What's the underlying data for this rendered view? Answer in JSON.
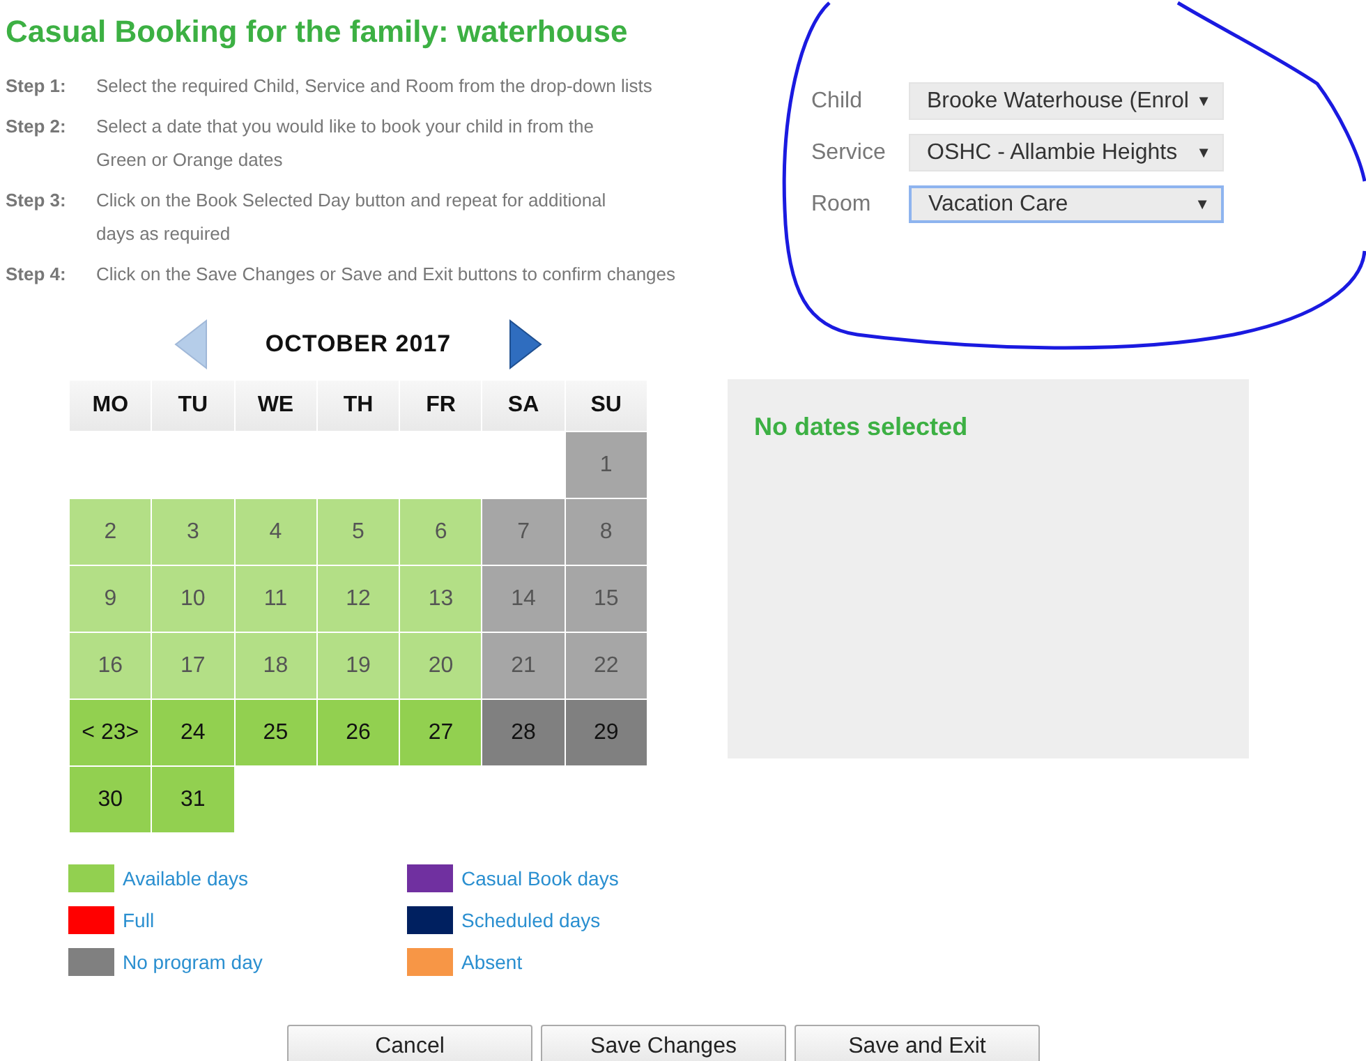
{
  "title": "Casual Booking for the family: waterhouse",
  "steps": [
    {
      "label": "Step 1:",
      "text": "Select the required Child, Service and Room from the drop-down lists"
    },
    {
      "label": "Step 2:",
      "text": "Select a date that you would like to book your child in from the Green or Orange dates"
    },
    {
      "label": "Step 3:",
      "text": "Click on the Book Selected Day button and repeat for additional days as required"
    },
    {
      "label": "Step 4:",
      "text": "Click on the Save Changes or Save and Exit buttons to confirm changes"
    }
  ],
  "selectors": [
    {
      "label": "Child",
      "value": "Brooke Waterhouse (Enrol",
      "caret": "▼",
      "focused": false
    },
    {
      "label": "Service",
      "value": "OSHC - Allambie Heights",
      "caret": "▼",
      "focused": false
    },
    {
      "label": "Room",
      "value": "Vacation Care",
      "caret": "▼",
      "focused": true
    }
  ],
  "calendar": {
    "month": "OCTOBER 2017",
    "prev_enabled": false,
    "next_enabled": true,
    "weekdays": [
      "MO",
      "TU",
      "WE",
      "TH",
      "FR",
      "SA",
      "SU"
    ],
    "weeks": [
      [
        {
          "day": "1",
          "kind": "past-closed"
        }
      ],
      [
        {
          "day": "2",
          "kind": "past"
        },
        {
          "day": "3",
          "kind": "past"
        },
        {
          "day": "4",
          "kind": "past"
        },
        {
          "day": "5",
          "kind": "past"
        },
        {
          "day": "6",
          "kind": "past"
        },
        {
          "day": "7",
          "kind": "past-closed"
        },
        {
          "day": "8",
          "kind": "past-closed"
        }
      ],
      [
        {
          "day": "9",
          "kind": "past"
        },
        {
          "day": "10",
          "kind": "past"
        },
        {
          "day": "11",
          "kind": "past"
        },
        {
          "day": "12",
          "kind": "past"
        },
        {
          "day": "13",
          "kind": "past"
        },
        {
          "day": "14",
          "kind": "past-closed"
        },
        {
          "day": "15",
          "kind": "past-closed"
        }
      ],
      [
        {
          "day": "16",
          "kind": "past"
        },
        {
          "day": "17",
          "kind": "past"
        },
        {
          "day": "18",
          "kind": "past"
        },
        {
          "day": "19",
          "kind": "past"
        },
        {
          "day": "20",
          "kind": "past"
        },
        {
          "day": "21",
          "kind": "past-closed"
        },
        {
          "day": "22",
          "kind": "past-closed"
        }
      ],
      [
        {
          "day": "< 23>",
          "kind": "available"
        },
        {
          "day": "24",
          "kind": "available"
        },
        {
          "day": "25",
          "kind": "available"
        },
        {
          "day": "26",
          "kind": "available"
        },
        {
          "day": "27",
          "kind": "available"
        },
        {
          "day": "28",
          "kind": "closed"
        },
        {
          "day": "29",
          "kind": "closed"
        }
      ],
      [
        {
          "day": "30",
          "kind": "available"
        },
        {
          "day": "31",
          "kind": "available"
        }
      ]
    ]
  },
  "selection_panel": {
    "message": "No dates selected"
  },
  "legend": [
    {
      "label": "Available days",
      "color": "#92d050"
    },
    {
      "label": "Casual Book days",
      "color": "#7030a0"
    },
    {
      "label": "Full",
      "color": "#ff0000"
    },
    {
      "label": "Scheduled days",
      "color": "#002060"
    },
    {
      "label": "No program day",
      "color": "#808080"
    },
    {
      "label": "Absent",
      "color": "#f79646"
    }
  ],
  "buttons": [
    "Cancel",
    "Save Changes",
    "Save and Exit"
  ]
}
